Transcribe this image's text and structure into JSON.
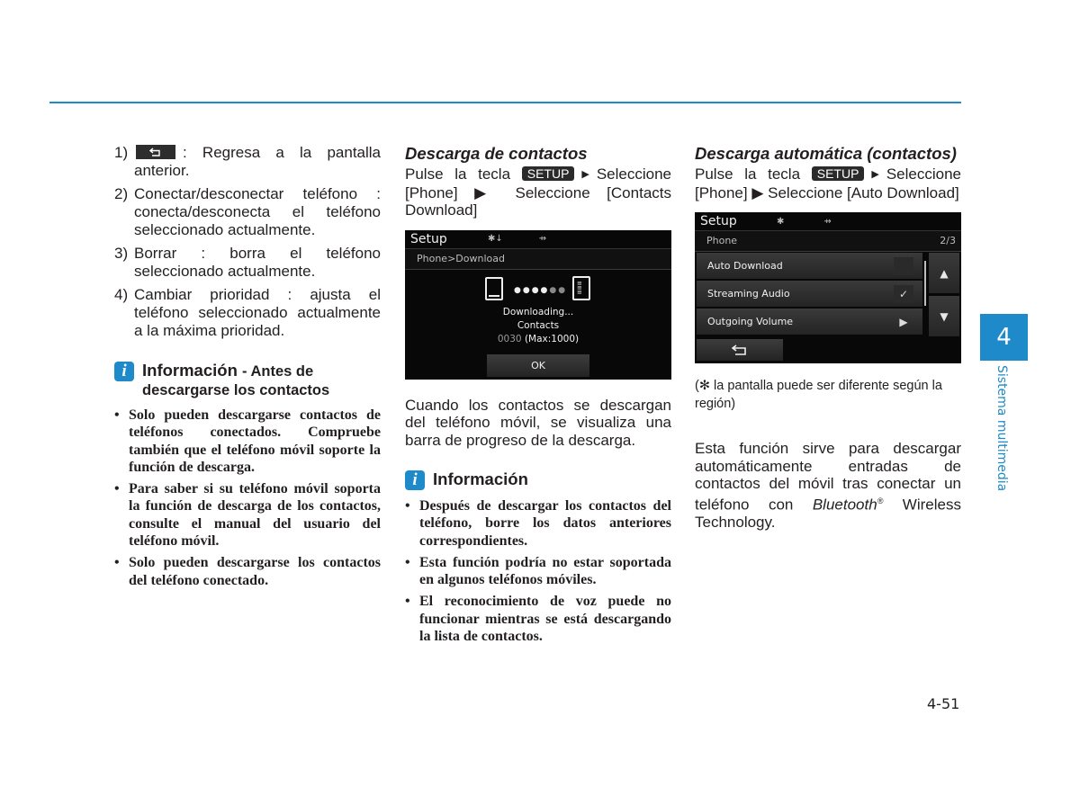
{
  "page": {
    "chapter_number": "4",
    "chapter_title": "Sistema multimedia",
    "page_number": "4-51",
    "accent_color": "#1f8ac9"
  },
  "col1": {
    "items": [
      {
        "num": "1)",
        "text": ": Regresa a la pantalla anterior.",
        "icon": "back-arrow-icon"
      },
      {
        "num": "2)",
        "text": "Conectar/desconectar teléfono : conecta/desconecta el teléfono seleccionado actualmente."
      },
      {
        "num": "3)",
        "text": "Borrar : borra el teléfono seleccionado actualmente."
      },
      {
        "num": "4)",
        "text": "Cambiar prioridad : ajusta el teléfono seleccionado actualmente a la máxima prioridad."
      }
    ],
    "info": {
      "icon": "i",
      "title": "Información",
      "subtitle": "- Antes de descargarse los contactos",
      "bullets": [
        "Solo pueden descargarse contactos de teléfonos conectados. Compruebe también que el teléfono móvil soporte la función de descarga.",
        "Para saber si su teléfono móvil soporta la función de descarga de los contactos, consulte el manual del usuario del teléfono móvil.",
        "Solo pueden descargarse los contactos del teléfono conectado."
      ]
    }
  },
  "col2": {
    "title": "Descarga de contactos",
    "instr_pre": "Pulse la tecla",
    "key": "SETUP",
    "instr_post": "Seleccione [Phone] ▶ Seleccione [Contacts Download]",
    "screen": {
      "title": "Setup",
      "breadcrumb": "Phone>Download",
      "line1": "Downloading...",
      "line2": "Contacts",
      "count": "0030",
      "max": "(Max:1000)",
      "ok": "OK"
    },
    "paragraph": "Cuando los contactos se descargan del teléfono móvil, se visualiza una barra de progreso de la descarga.",
    "info": {
      "icon": "i",
      "title": "Información",
      "bullets": [
        "Después de descargar los contactos del teléfono, borre los datos anteriores correspondientes.",
        "Esta función podría no estar soportada en algunos teléfonos móviles.",
        "El reconocimiento de voz puede no funcionar mientras se está descargando la lista de contactos."
      ]
    }
  },
  "col3": {
    "title": "Descarga automática (contactos)",
    "instr_pre": "Pulse la tecla",
    "key": "SETUP",
    "instr_post": "Seleccione [Phone] ▶ Seleccione [Auto Download]",
    "screen": {
      "title": "Setup",
      "breadcrumb": "Phone",
      "page_indicator": "2/3",
      "rows": [
        {
          "label": "Auto Download",
          "control": "checkbox-unchecked"
        },
        {
          "label": "Streaming Audio",
          "control": "checkbox-checked"
        },
        {
          "label": "Outgoing Volume",
          "control": "arrow-right"
        }
      ]
    },
    "note": "(✻ la pantalla puede ser diferente según la región)",
    "para_pre": "Esta función sirve para descargar automáticamente entradas de contactos del móvil tras conectar un teléfono con",
    "para_brand": "Bluetooth",
    "para_reg": "®",
    "para_post": "Wireless Technology."
  }
}
